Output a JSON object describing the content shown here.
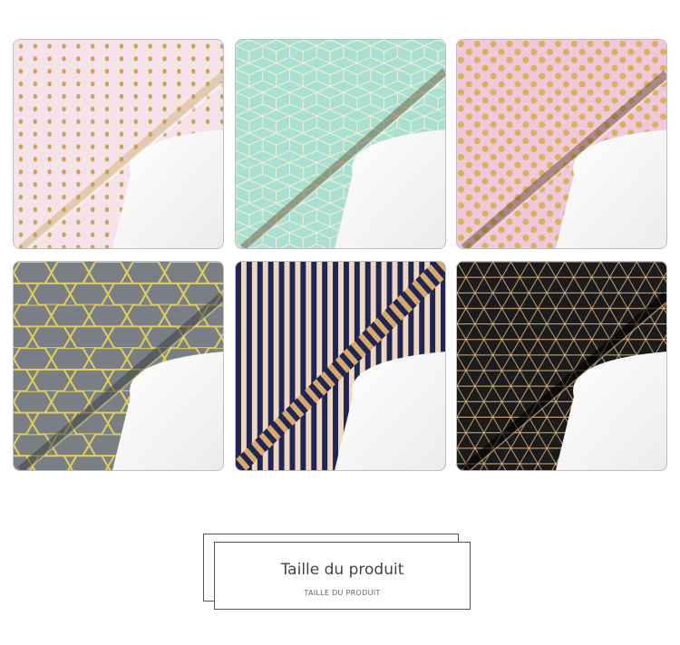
{
  "products": [
    {
      "name": "paper-gold-dots-light-pink",
      "pattern": "small-dots",
      "background": "#f4e4ea",
      "accent": "#caa255"
    },
    {
      "name": "paper-gold-cubes-mint",
      "pattern": "cubes",
      "background": "#a9e0d2",
      "accent": "#d6b66a"
    },
    {
      "name": "paper-gold-polka-dots-pink",
      "pattern": "polka-dots",
      "background": "#f0c8dc",
      "accent": "#d2a64e"
    },
    {
      "name": "paper-gold-hexagons-grey",
      "pattern": "hexagons",
      "background": "#7a7f86",
      "accent": "#e3cf5a"
    },
    {
      "name": "paper-gold-stripes-navy",
      "pattern": "stripes",
      "background": "#f0d7bf",
      "accent": "#1f2554"
    },
    {
      "name": "paper-gold-triangles-black",
      "pattern": "triangles",
      "background": "#1b1b1b",
      "accent": "#d7b07e"
    }
  ],
  "section": {
    "title": "Taille du produit",
    "subtitle": "TAILLE DU PRODUIT"
  }
}
